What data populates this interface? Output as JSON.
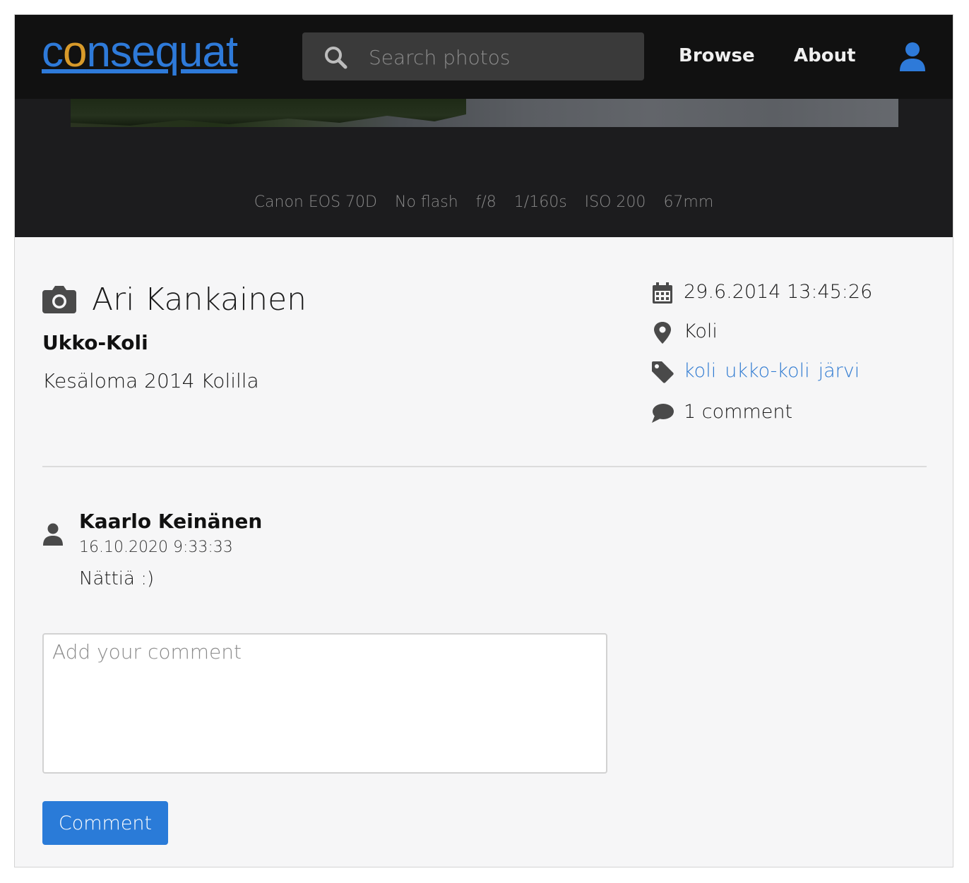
{
  "header": {
    "logo_text": "consequat",
    "search_placeholder": "Search photos",
    "nav": {
      "browse": "Browse",
      "about": "About"
    }
  },
  "exif": {
    "camera": "Canon EOS 70D",
    "flash": "No flash",
    "aperture": "f/8",
    "shutter": "1/160s",
    "iso": "ISO 200",
    "focal_length": "67mm"
  },
  "photo": {
    "author": "Ari Kankainen",
    "title": "Ukko-Koli",
    "description": "Kesäloma 2014 Kolilla",
    "date": "29.6.2014 13:45:26",
    "location": "Koli",
    "tags": [
      "koli",
      "ukko-koli",
      "järvi"
    ],
    "comment_count": "1 comment"
  },
  "comments": [
    {
      "author": "Kaarlo Keinänen",
      "time": "16.10.2020 9:33:33",
      "text": "Nättiä :)"
    }
  ],
  "comment_form": {
    "placeholder": "Add your comment",
    "button": "Comment"
  },
  "colors": {
    "brand_blue": "#2e7ad9",
    "logo_accent": "#d89a2a",
    "link": "#2f7ad1",
    "button": "#2a7bd8"
  },
  "icons": [
    "search-icon",
    "user-icon",
    "camera-icon",
    "calendar-icon",
    "map-marker-icon",
    "tag-icon",
    "comment-icon",
    "avatar-icon"
  ]
}
